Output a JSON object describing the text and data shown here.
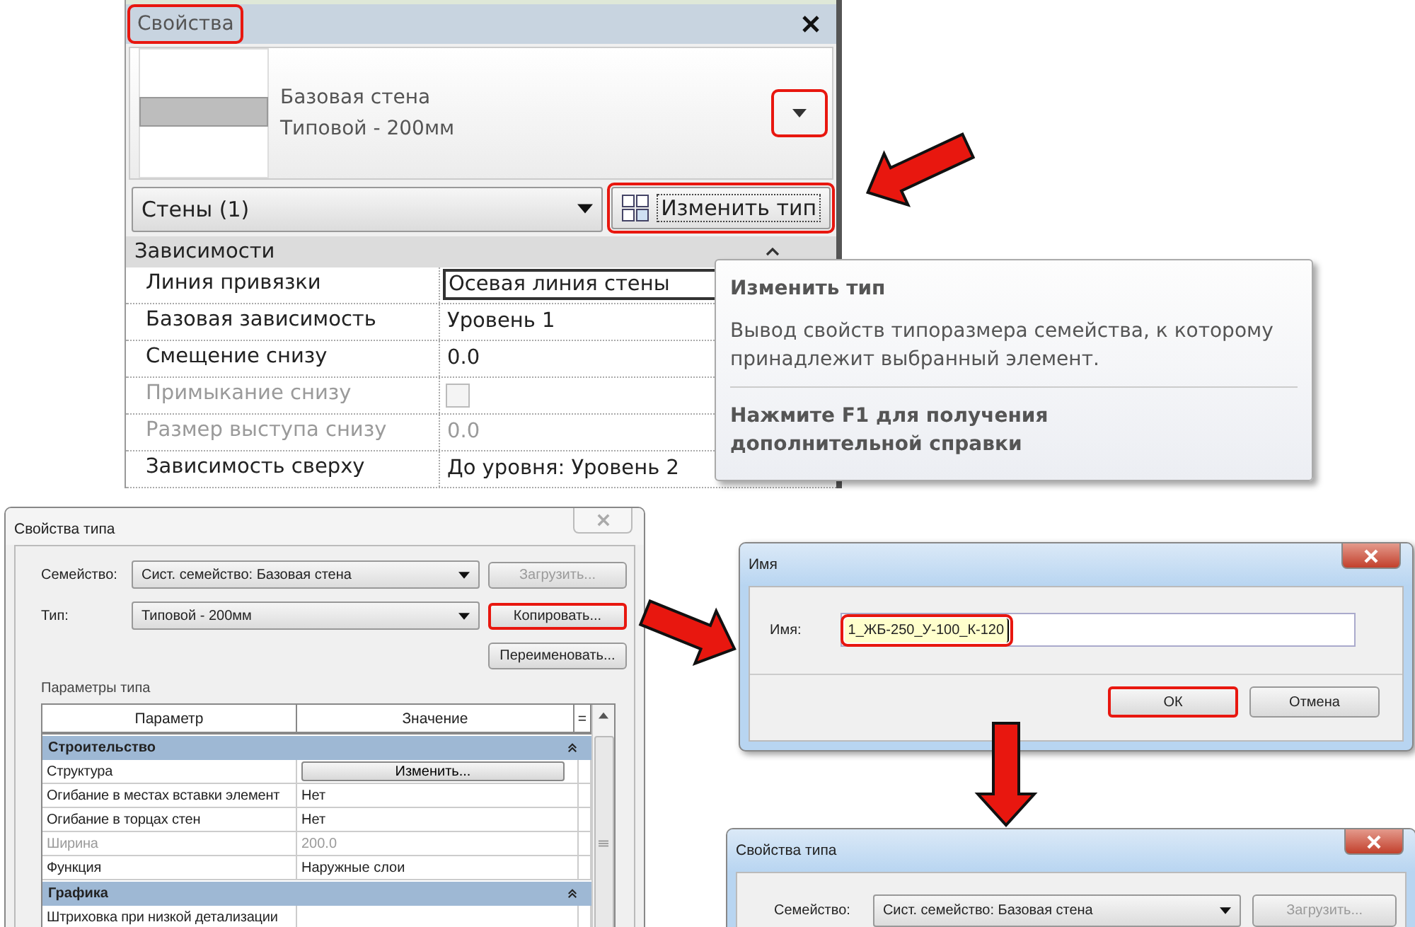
{
  "properties_panel": {
    "title": "Свойства",
    "title_highlighted": true,
    "type_selector": {
      "family": "Базовая стена",
      "type": "Типовой - 200мм",
      "dropdown_highlighted": true
    },
    "category_filter": {
      "value": "Стены (1)"
    },
    "edit_type_button": {
      "label": "Изменить тип",
      "highlighted": true
    },
    "section": "Зависимости",
    "rows": [
      {
        "label": "Линия привязки",
        "value": "Осевая линия стены",
        "kind": "text",
        "disabled": false,
        "selected": true
      },
      {
        "label": "Базовая зависимость",
        "value": "Уровень 1",
        "kind": "text",
        "disabled": false,
        "selected": false
      },
      {
        "label": "Смещение снизу",
        "value": "0.0",
        "kind": "text",
        "disabled": false,
        "selected": false
      },
      {
        "label": "Примыкание снизу",
        "kind": "checkbox",
        "checked": false,
        "disabled": true,
        "selected": false
      },
      {
        "label": "Размер выступа снизу",
        "value": "0.0",
        "kind": "text",
        "disabled": true,
        "selected": false
      },
      {
        "label": "Зависимость сверху",
        "value": "До уровня: Уровень 2",
        "kind": "text",
        "disabled": false,
        "selected": false
      }
    ]
  },
  "tooltip": {
    "title": "Изменить тип",
    "description": "Вывод свойств типоразмера семейства, к которому принадлежит выбранный элемент.",
    "hint": "Нажмите F1 для получения дополнительной справки"
  },
  "type_dialog": {
    "title": "Свойства типа",
    "fields": [
      {
        "label": "Семейство:",
        "value": "Сист. семейство: Базовая стена"
      },
      {
        "label": "Тип:",
        "value": "Типовой - 200мм"
      }
    ],
    "buttons": [
      {
        "label": "Загрузить...",
        "disabled": true,
        "highlighted": false
      },
      {
        "label": "Копировать...",
        "disabled": false,
        "highlighted": true
      },
      {
        "label": "Переименовать...",
        "disabled": false,
        "highlighted": false
      }
    ],
    "params_label": "Параметры типа",
    "columns": [
      "Параметр",
      "Значение",
      "="
    ],
    "groups": [
      {
        "name": "Строительство",
        "rows": [
          {
            "param": "Структура",
            "value": "Изменить...",
            "kind": "button",
            "disabled": false
          },
          {
            "param": "Огибание в местах вставки элемент",
            "value": "Нет",
            "kind": "text",
            "disabled": false
          },
          {
            "param": "Огибание в торцах стен",
            "value": "Нет",
            "kind": "text",
            "disabled": false
          },
          {
            "param": "Ширина",
            "value": "200.0",
            "kind": "text",
            "disabled": true
          },
          {
            "param": "Функция",
            "value": "Наружные слои",
            "kind": "text",
            "disabled": false
          }
        ]
      },
      {
        "name": "Графика",
        "rows": [
          {
            "param": "Штриховка при низкой детализации",
            "kind": "text",
            "disabled": false
          }
        ]
      }
    ]
  },
  "name_dialog": {
    "title": "Имя",
    "label": "Имя:",
    "value": "1_ЖБ-250_У-100_К-120",
    "value_highlighted": true,
    "buttons": [
      {
        "label": "ОК",
        "highlighted": true
      },
      {
        "label": "Отмена",
        "highlighted": false
      }
    ]
  },
  "type_dialog_2": {
    "title": "Свойства типа",
    "field": {
      "label": "Семейство:",
      "value": "Сист. семейство: Базовая стена"
    },
    "button": {
      "label": "Загрузить...",
      "disabled": true
    }
  }
}
